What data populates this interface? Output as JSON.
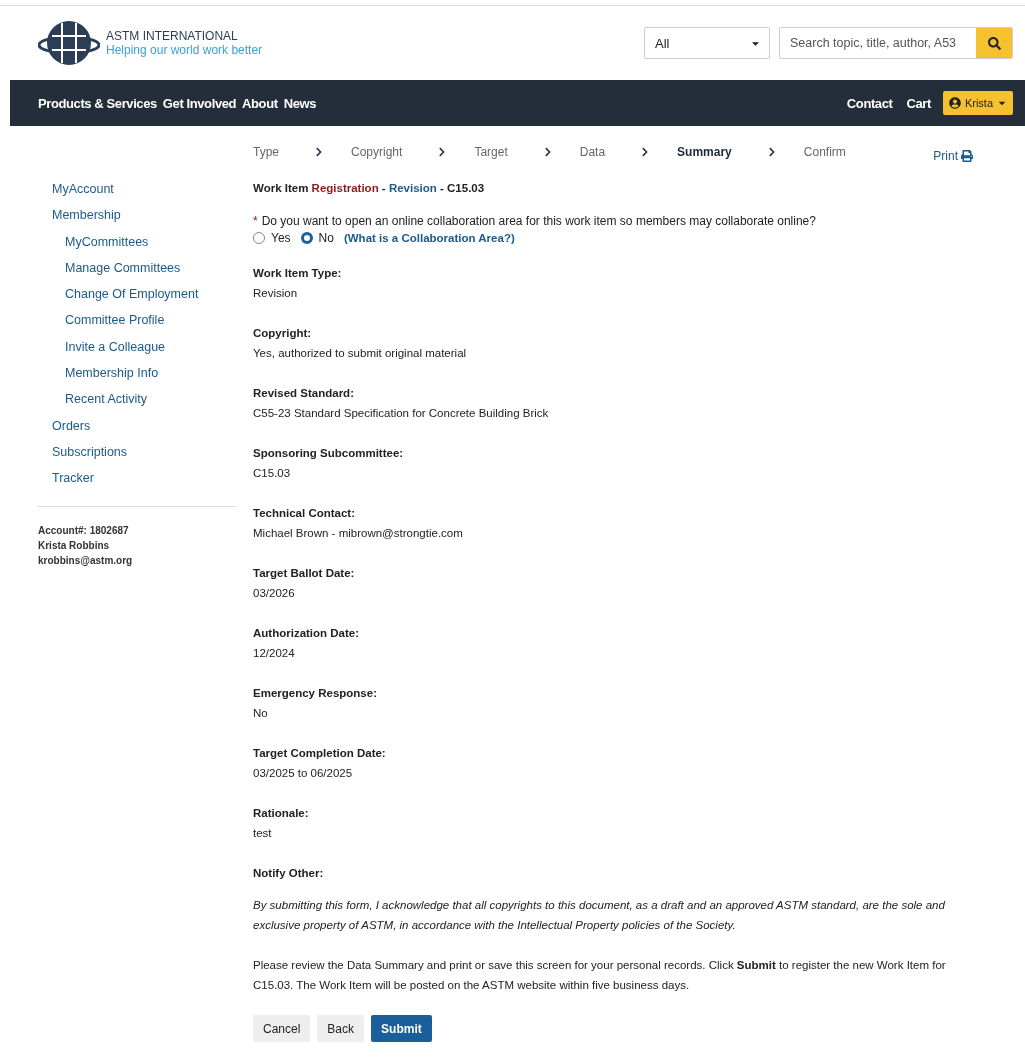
{
  "header": {
    "brand": "ASTM INTERNATIONAL",
    "tagline": "Helping our world work better",
    "scope_select": {
      "value": "All"
    },
    "search": {
      "placeholder": "Search topic, title, author, A53"
    }
  },
  "nav": {
    "items": [
      "Products & Services",
      "Get Involved",
      "About",
      "News"
    ],
    "right_items": [
      "Contact",
      "Cart"
    ],
    "user_button": "Krista"
  },
  "steps": [
    {
      "label": "Type",
      "selected": false
    },
    {
      "label": "Copyright",
      "selected": false
    },
    {
      "label": "Target",
      "selected": false
    },
    {
      "label": "Data",
      "selected": false
    },
    {
      "label": "Summary",
      "selected": true
    },
    {
      "label": "Confirm",
      "selected": false
    }
  ],
  "print_link": "Print",
  "sidebar": {
    "items": [
      {
        "label": "MyAccount"
      },
      {
        "label": "Membership",
        "children": [
          {
            "label": "MyCommittees"
          },
          {
            "label": "Manage Committees"
          },
          {
            "label": "Change Of Employment"
          },
          {
            "label": "Committee Profile"
          },
          {
            "label": "Invite a Colleague"
          },
          {
            "label": "Membership Info"
          },
          {
            "label": "Recent Activity"
          }
        ]
      },
      {
        "label": "Orders"
      },
      {
        "label": "Subscriptions"
      },
      {
        "label": "Tracker"
      }
    ],
    "account": [
      "Account#: 1802687",
      "Krista Robbins",
      "krobbins@astm.org"
    ]
  },
  "page_title": [
    {
      "kind": "plain",
      "text": "Work Item "
    },
    {
      "kind": "accent",
      "text": "Registration"
    },
    {
      "kind": "plain",
      "text": " - "
    },
    {
      "kind": "link",
      "text": "Revision"
    },
    {
      "kind": "plain",
      "text": " - C15.03"
    }
  ],
  "question": {
    "required_mark": "*",
    "text": "Do you want to open an online collaboration area for this work item so members may collaborate online?",
    "options": [
      {
        "label": "Yes",
        "selected": false
      },
      {
        "label": "No",
        "selected": true
      }
    ],
    "help_link": "(What is a Collaboration Area?)"
  },
  "fields": [
    {
      "label": "Work Item Type:",
      "value": "Revision"
    },
    {
      "label": "Copyright:",
      "value": "Yes, authorized to submit original material"
    },
    {
      "label": "Revised Standard:",
      "value": "C55-23 Standard Specification for Concrete Building Brick"
    },
    {
      "label": "Sponsoring Subcommittee:",
      "value": "C15.03"
    },
    {
      "label": "Technical Contact:",
      "value": "Michael Brown - mibrown@strongtie.com"
    },
    {
      "label": "Target Ballot Date:",
      "value": "03/2026"
    },
    {
      "label": "Authorization Date:",
      "value": "12/2024"
    },
    {
      "label": "Emergency Response:",
      "value": "No"
    },
    {
      "label": "Target Completion Date:",
      "value": "03/2025 to 06/2025"
    },
    {
      "label": "Rationale:",
      "value": "test"
    },
    {
      "label": "Notify Other:"
    }
  ],
  "disclaimer": "By submitting this form, I acknowledge that all copyrights to this document, as a draft and an approved ASTM standard, are the sole and exclusive property of ASTM, in accordance with the Intellectual Property policies of the Society.",
  "review_note": "Please review the Data Summary and print or save this screen for your personal records. Click **Submit** to register the new Work Item for C15.03. The Work Item will be posted on the ASTM website within five business days.",
  "buttons": [
    {
      "label": "Cancel",
      "kind": "secondary"
    },
    {
      "label": "Back",
      "kind": "secondary"
    },
    {
      "label": "Submit",
      "kind": "primary"
    }
  ]
}
